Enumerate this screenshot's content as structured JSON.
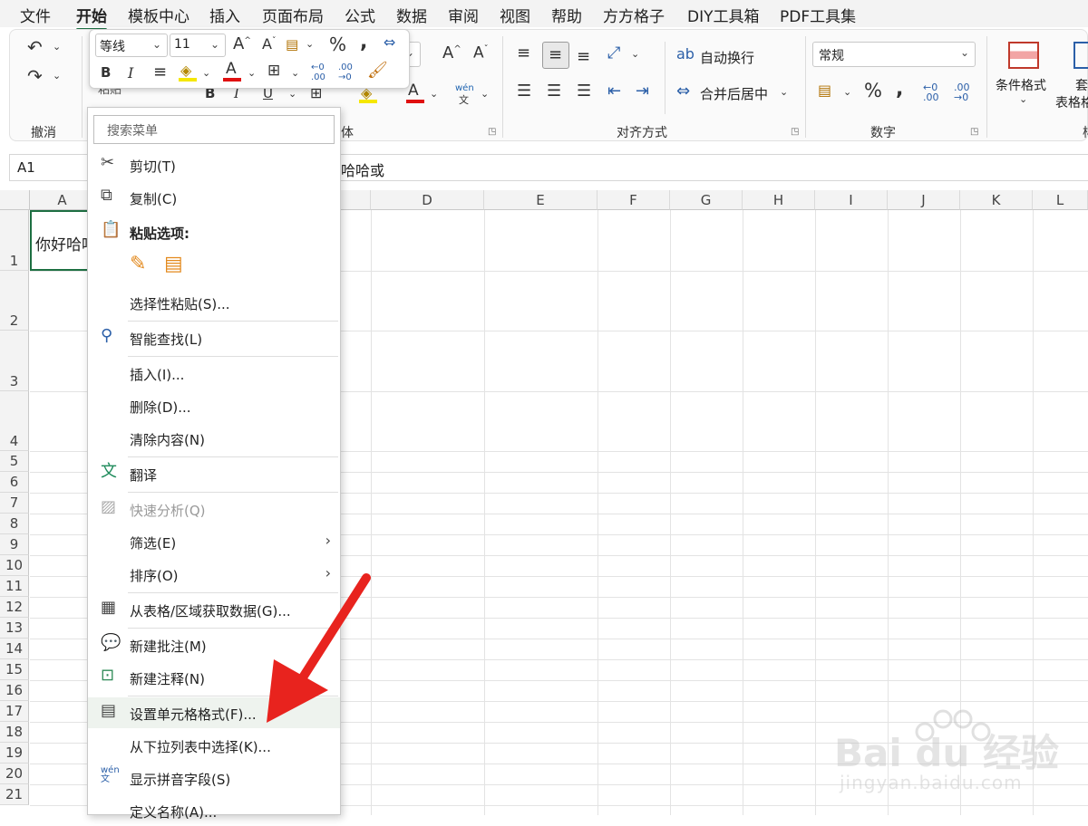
{
  "menu_tabs": [
    "文件",
    "开始",
    "模板中心",
    "插入",
    "页面布局",
    "公式",
    "数据",
    "审阅",
    "视图",
    "帮助",
    "方方格子",
    "DIY工具箱",
    "PDF工具集"
  ],
  "active_tab": "开始",
  "ribbon": {
    "undo_group_label": "撤消",
    "font_group_label": "体",
    "align_group_label": "对齐方式",
    "number_group_label": "数字",
    "wrap_text": "自动换行",
    "merge_center": "合并后居中",
    "number_format": "常规",
    "conditional_format": "条件格式",
    "table_format_1": "套",
    "table_format_2": "表格格",
    "paste_fragment": "粘贴",
    "phonetic": "wén",
    "phonetic_char": "文"
  },
  "mini_toolbar": {
    "font_name": "等线",
    "font_size": "11"
  },
  "formula_bar": {
    "name_box": "A1",
    "content": "哈哈哈或"
  },
  "columns": [
    "A",
    "D",
    "E",
    "F",
    "G",
    "H",
    "I",
    "J",
    "K",
    "L"
  ],
  "rows": [
    "1",
    "2",
    "3",
    "4",
    "5",
    "6",
    "7",
    "8",
    "9",
    "10",
    "11",
    "12",
    "13",
    "14",
    "15",
    "16",
    "17",
    "18",
    "19",
    "20",
    "21"
  ],
  "cell_a1": "你好哈哈",
  "context_menu": {
    "search_placeholder": "搜索菜单",
    "cut": "剪切(T)",
    "copy": "复制(C)",
    "paste_options": "粘贴选项:",
    "paste_special": "选择性粘贴(S)...",
    "smart_lookup": "智能查找(L)",
    "insert": "插入(I)...",
    "delete": "删除(D)...",
    "clear": "清除内容(N)",
    "translate": "翻译",
    "quick_analysis": "快速分析(Q)",
    "filter": "筛选(E)",
    "sort": "排序(O)",
    "get_data": "从表格/区域获取数据(G)...",
    "new_comment": "新建批注(M)",
    "new_note": "新建注释(N)",
    "format_cells": "设置单元格格式(F)...",
    "pick_list": "从下拉列表中选择(K)...",
    "phonetic": "显示拼音字段(S)",
    "define_name": "定义名称(A)..."
  },
  "watermark": {
    "brand": "Bai du 经验",
    "url": "jingyan.baidu.com"
  },
  "colors": {
    "accent": "#1d6f42",
    "arrow": "#e8231e",
    "highlight": "#eef3ee"
  }
}
